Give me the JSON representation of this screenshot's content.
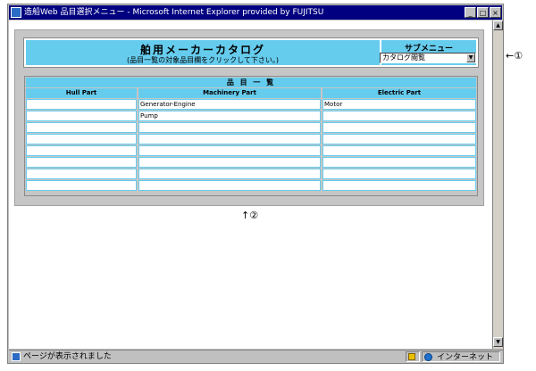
{
  "window": {
    "title": "造船Web 品目選択メニュー - Microsoft Internet Explorer provided by FUJITSU",
    "minimize": "_",
    "maximize": "□",
    "close": "×"
  },
  "header": {
    "title": "舶用メーカーカタログ",
    "subtitle": "(品目一覧の対象品目欄をクリックして下さい。)",
    "submenu_label": "サブメニュー",
    "submenu_value": "カタログ閲覧"
  },
  "parts_table": {
    "caption": "品 目 一 覧",
    "columns": [
      "Hull Part",
      "Machinery Part",
      "Electric Part"
    ],
    "rows": [
      [
        "",
        "Generator-Engine",
        "Motor"
      ],
      [
        "",
        "Pump",
        ""
      ],
      [
        "",
        "",
        ""
      ],
      [
        "",
        "",
        ""
      ],
      [
        "",
        "",
        ""
      ],
      [
        "",
        "",
        ""
      ],
      [
        "",
        "",
        ""
      ],
      [
        "",
        "",
        ""
      ]
    ]
  },
  "annotations": {
    "right_marker": "←①",
    "bottom_marker": "↑②"
  },
  "statusbar": {
    "message": "ページが表示されました",
    "zone": "インターネット"
  },
  "colors": {
    "accent": "#66ccee",
    "panel": "#c6c6c6",
    "titlebar": "#000080"
  }
}
